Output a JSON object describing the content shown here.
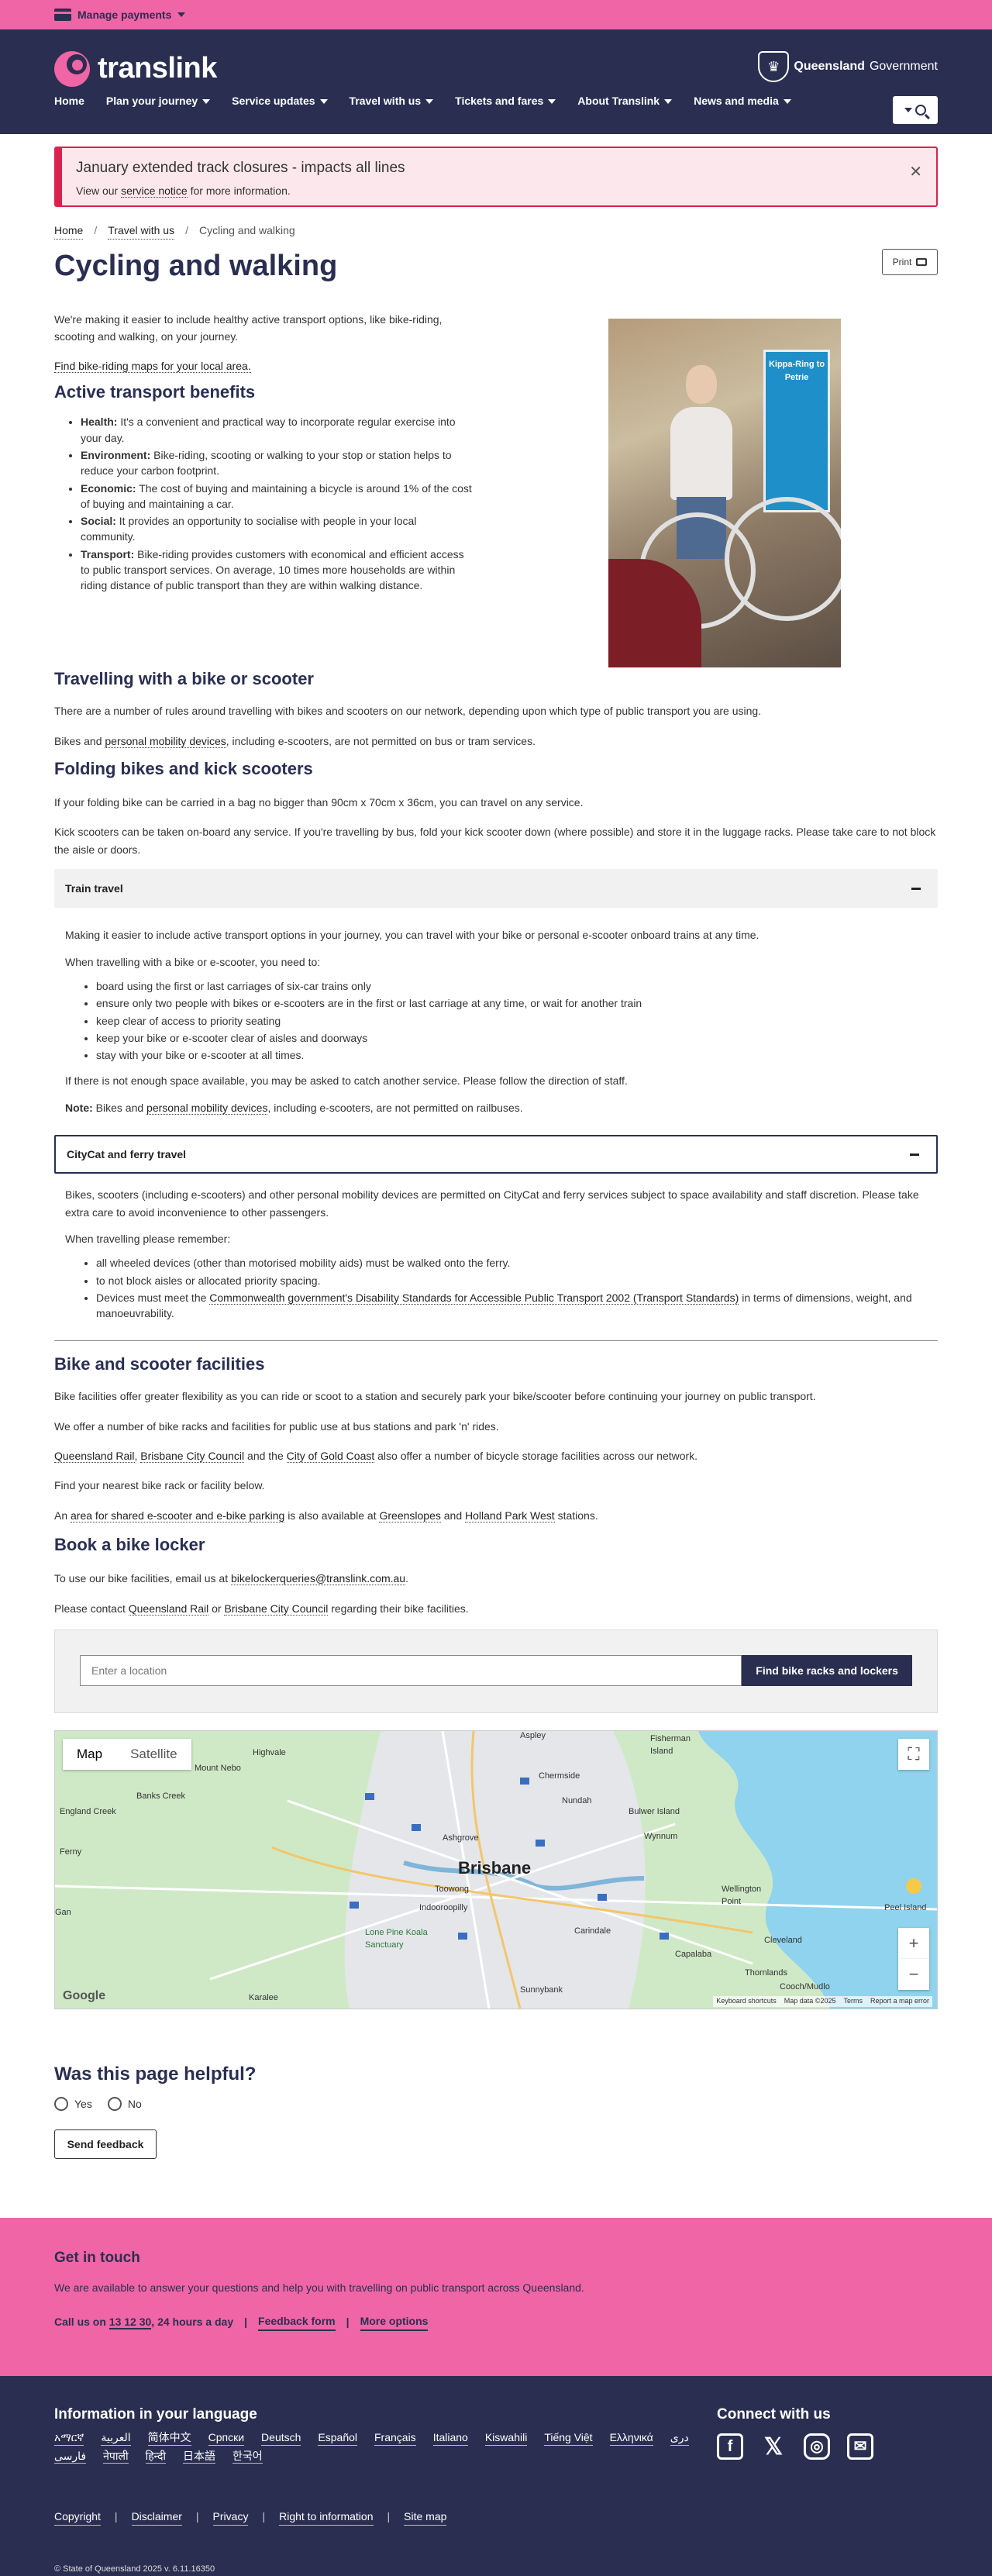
{
  "topbar": {
    "manage_payments": "Manage payments"
  },
  "header": {
    "logo": "translink",
    "gov": "Queensland",
    "gov2": "Government",
    "nav": [
      "Home",
      "Plan your journey",
      "Service updates",
      "Travel with us",
      "Tickets and fares",
      "About Translink",
      "News and media"
    ]
  },
  "alert": {
    "title": "January extended track closures - impacts all lines",
    "pre": "View our",
    "link": "service notice",
    "post": "for more information."
  },
  "breadcrumb": [
    "Home",
    "Travel with us",
    "Cycling and walking"
  ],
  "page": {
    "title": "Cycling and walking",
    "print": "Print",
    "intro": "We're making it easier to include healthy active transport options, like bike-riding, scooting and walking, on your journey.",
    "maps_link": "Find bike-riding maps for your local area.",
    "photo_sign": "Kippa-Ring to Petrie"
  },
  "benefits": {
    "heading": "Active transport benefits",
    "items": [
      {
        "k": "Health:",
        "v": "It's a convenient and practical way to incorporate regular exercise into your day."
      },
      {
        "k": "Environment:",
        "v": "Bike-riding, scooting or walking to your stop or station helps to reduce your carbon footprint."
      },
      {
        "k": "Economic:",
        "v": "The cost of buying and maintaining a bicycle is around 1% of the cost of buying and maintaining a car."
      },
      {
        "k": "Social:",
        "v": "It provides an opportunity to socialise with people in your local community."
      },
      {
        "k": "Transport:",
        "v": "Bike-riding provides customers with economical and efficient access to public transport services. On average, 10 times more households are within riding distance of public transport than they are within walking distance."
      }
    ]
  },
  "travelling": {
    "heading": "Travelling with a bike or scooter",
    "p1": "There are a number of rules around travelling with bikes and scooters on our network, depending upon which type of public transport you are using.",
    "p2_pre": "Bikes and",
    "p2_link": "personal mobility devices",
    "p2_post": ", including e-scooters, are not permitted on bus or tram services."
  },
  "folding": {
    "heading": "Folding bikes and kick scooters",
    "p1": "If your folding bike can be carried in a bag no bigger than 90cm x 70cm x 36cm, you can travel on any service.",
    "p2": "Kick scooters can be taken on-board any service. If you're travelling by bus, fold your kick scooter down (where possible) and store it in the luggage racks. Please take care to not block the aisle or doors."
  },
  "train": {
    "heading": "Train travel",
    "p1": "Making it easier to include active transport options in your journey, you can travel with your bike or personal e-scooter onboard trains at any time.",
    "p2": "When travelling with a bike or e-scooter, you need to:",
    "items": [
      "board using the first or last carriages of six-car trains only",
      "ensure only two people with bikes or e-scooters are in the first or last carriage at any time, or wait for another train",
      "keep clear of access to priority seating",
      "keep your bike or e-scooter clear of aisles and doorways",
      "stay with your bike or e-scooter at all times."
    ],
    "p3": "If there is not enough space available, you may be asked to catch another service. Please follow the direction of staff.",
    "note_k": "Note:",
    "note_pre": "Bikes and",
    "note_link": "personal mobility devices",
    "note_post": ", including e-scooters, are not permitted on railbuses."
  },
  "ferry": {
    "heading": "CityCat and ferry travel",
    "p1": "Bikes, scooters (including e-scooters) and other personal mobility devices are permitted on CityCat and ferry services subject to space availability and staff discretion. Please take extra care to avoid inconvenience to other passengers.",
    "p2": "When travelling please remember:",
    "i1": "all wheeled devices (other than motorised mobility aids) must be walked onto the ferry.",
    "i2": "to not block aisles or allocated priority spacing.",
    "i3_pre": "Devices must meet the",
    "i3_link": "Commonwealth government's Disability Standards for Accessible Public Transport 2002 (Transport Standards)",
    "i3_post": "in terms of dimensions, weight, and manoeuvrability."
  },
  "facilities": {
    "heading": "Bike and scooter facilities",
    "p1": "Bike facilities offer greater flexibility as you can ride or scoot to a station and securely park your bike/scooter before continuing your journey on public transport.",
    "p2": "We offer a number of bike racks and facilities for public use at bus stations and park 'n' rides.",
    "l1": "Queensland Rail",
    "l2": "Brisbane City Council",
    "and": "and the",
    "l3": "City of Gold Coast",
    "p3_post": "also offer a number of bicycle storage facilities across our network.",
    "p4": "Find your nearest bike rack or facility below.",
    "p5_pre": "An",
    "p5_link": "area for shared e-scooter and e-bike parking",
    "p5_mid": "is also available at",
    "p5_l2": "Greenslopes",
    "p5_and": "and",
    "p5_l3": "Holland Park West",
    "p5_post": "stations."
  },
  "locker": {
    "heading": "Book a bike locker",
    "p1_pre": "To use our bike facilities, email us at",
    "email": "bikelockerqueries@translink.com.au",
    "p2_pre": "Please contact",
    "l1": "Queensland Rail",
    "or": "or",
    "l2": "Brisbane City Council",
    "p2_post": "regarding their bike facilities."
  },
  "finder": {
    "placeholder": "Enter a location",
    "button": "Find bike racks and lockers"
  },
  "map": {
    "tab_map": "Map",
    "tab_sat": "Satellite",
    "city": "Brisbane",
    "places": [
      "Aspley",
      "Fisherman Island",
      "Highvale",
      "Mount Nebo",
      "Chermside",
      "Nundah",
      "Bulwer Island",
      "Banks Creek",
      "England Creek",
      "Ferny",
      "Ashgrove",
      "Wynnum",
      "Toowong",
      "Indooroopilly",
      "Lone Pine Koala Sanctuary",
      "Carindale",
      "Capalaba",
      "Wellington Point",
      "Peel Island",
      "Cleveland",
      "Thornlands",
      "Karalee",
      "Cooch/Mudlo",
      "Sunnybank",
      "Gan"
    ],
    "footer": [
      "Keyboard shortcuts",
      "Map data ©2025",
      "Terms",
      "Report a map error"
    ],
    "google": "Google"
  },
  "feedback": {
    "title": "Was this page helpful?",
    "yes": "Yes",
    "no": "No",
    "send": "Send feedback"
  },
  "touch": {
    "heading": "Get in touch",
    "text": "We are available to answer your questions and help you with travelling on public transport across Queensland.",
    "call_pre": "Call us on",
    "phone": "13 12 30",
    "call_post": ", 24 hours a day",
    "feedback": "Feedback form",
    "more": "More options"
  },
  "footer": {
    "lang_title": "Information in your language",
    "langs": [
      "አማርኛ",
      "العربية",
      "简体中文",
      "Српски",
      "Deutsch",
      "Español",
      "Français",
      "Italiano",
      "Kiswahili",
      "Tiếng Việt",
      "Ελληνικά",
      "دری",
      "فارسی",
      "नेपाली",
      "हिन्दी",
      "日本語",
      "한국어"
    ],
    "connect": "Connect with us",
    "links": [
      "Copyright",
      "Disclaimer",
      "Privacy",
      "Right to information",
      "Site map"
    ],
    "copyright": "© State of Queensland 2025",
    "version": "v. 6.11.16350"
  }
}
